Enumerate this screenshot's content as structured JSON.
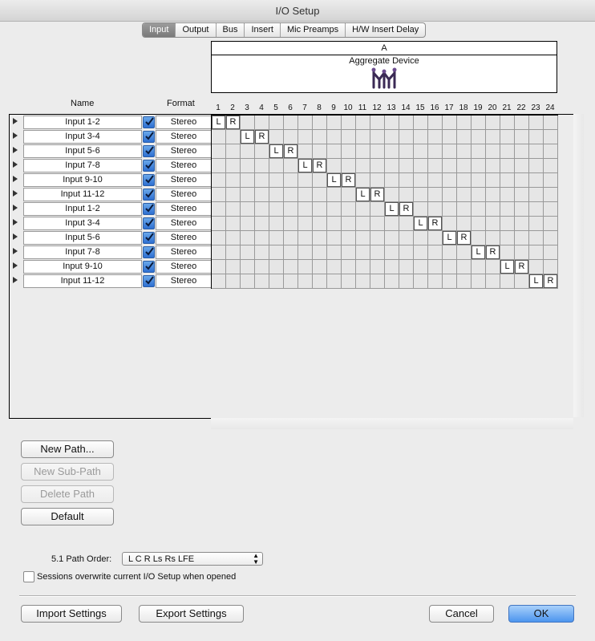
{
  "window": {
    "title": "I/O Setup"
  },
  "tabs": [
    {
      "label": "Input",
      "active": true
    },
    {
      "label": "Output",
      "active": false
    },
    {
      "label": "Bus",
      "active": false
    },
    {
      "label": "Insert",
      "active": false
    },
    {
      "label": "Mic Preamps",
      "active": false
    },
    {
      "label": "H/W Insert Delay",
      "active": false
    }
  ],
  "header": {
    "group_label": "A",
    "device_name": "Aggregate Device",
    "device_icon": "aggregate-device-icon",
    "name_col": "Name",
    "format_col": "Format"
  },
  "columns": [
    "1",
    "2",
    "3",
    "4",
    "5",
    "6",
    "7",
    "8",
    "9",
    "10",
    "11",
    "12",
    "13",
    "14",
    "15",
    "16",
    "17",
    "18",
    "19",
    "20",
    "21",
    "22",
    "23",
    "24"
  ],
  "paths": [
    {
      "name": "Input 1-2",
      "format": "Stereo",
      "enabled": true,
      "L": 1,
      "R": 2
    },
    {
      "name": "Input 3-4",
      "format": "Stereo",
      "enabled": true,
      "L": 3,
      "R": 4
    },
    {
      "name": "Input 5-6",
      "format": "Stereo",
      "enabled": true,
      "L": 5,
      "R": 6
    },
    {
      "name": "Input 7-8",
      "format": "Stereo",
      "enabled": true,
      "L": 7,
      "R": 8
    },
    {
      "name": "Input 9-10",
      "format": "Stereo",
      "enabled": true,
      "L": 9,
      "R": 10
    },
    {
      "name": "Input 11-12",
      "format": "Stereo",
      "enabled": true,
      "L": 11,
      "R": 12
    },
    {
      "name": "Input 1-2",
      "format": "Stereo",
      "enabled": true,
      "L": 13,
      "R": 14
    },
    {
      "name": "Input 3-4",
      "format": "Stereo",
      "enabled": true,
      "L": 15,
      "R": 16
    },
    {
      "name": "Input 5-6",
      "format": "Stereo",
      "enabled": true,
      "L": 17,
      "R": 18
    },
    {
      "name": "Input 7-8",
      "format": "Stereo",
      "enabled": true,
      "L": 19,
      "R": 20
    },
    {
      "name": "Input 9-10",
      "format": "Stereo",
      "enabled": true,
      "L": 21,
      "R": 22
    },
    {
      "name": "Input 11-12",
      "format": "Stereo",
      "enabled": true,
      "L": 23,
      "R": 24
    }
  ],
  "channel_labels": {
    "left": "L",
    "right": "R"
  },
  "buttons": {
    "new_path": "New Path...",
    "new_sub_path": "New Sub-Path",
    "delete_path": "Delete Path",
    "default": "Default",
    "import_settings": "Import Settings",
    "export_settings": "Export Settings",
    "cancel": "Cancel",
    "ok": "OK"
  },
  "path_order": {
    "label": "5.1 Path Order:",
    "value": "L C R Ls Rs LFE"
  },
  "sessions_overwrite": {
    "label": "Sessions overwrite current I/O Setup when opened",
    "checked": false
  },
  "colors": {
    "accent": "#4c95ee",
    "checkbox": "#2e6fd1"
  }
}
